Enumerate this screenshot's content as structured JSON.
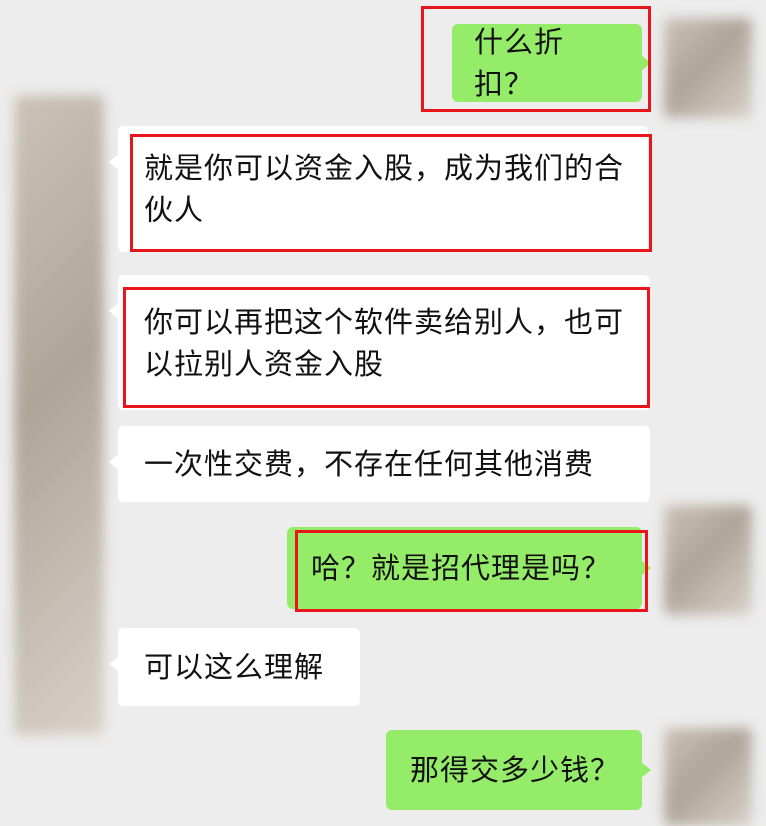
{
  "chat": {
    "messages": [
      {
        "side": "me",
        "text": "什么折扣？"
      },
      {
        "side": "other",
        "text": "就是你可以资金入股，成为我们的合伙人"
      },
      {
        "side": "other",
        "text": "你可以再把这个软件卖给别人，也可以拉别人资金入股"
      },
      {
        "side": "other",
        "text": "一次性交费，不存在任何其他消费"
      },
      {
        "side": "me",
        "text": "哈？就是招代理是吗？"
      },
      {
        "side": "other",
        "text": "可以这么理解"
      },
      {
        "side": "me",
        "text": "那得交多少钱？"
      }
    ]
  },
  "colors": {
    "background": "#ededed",
    "self_bubble": "#95ec69",
    "other_bubble": "#ffffff",
    "highlight_box": "#e8161b"
  }
}
